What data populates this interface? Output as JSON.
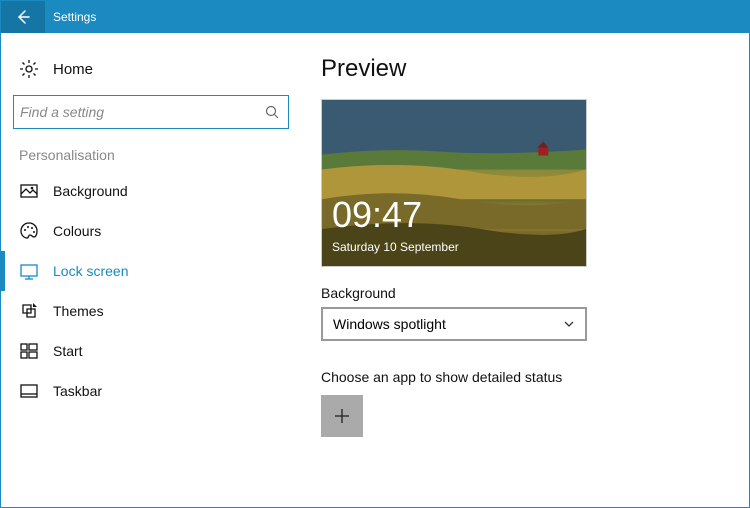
{
  "window": {
    "title": "Settings"
  },
  "sidebar": {
    "home_label": "Home",
    "search_placeholder": "Find a setting",
    "section_title": "Personalisation",
    "items": [
      {
        "label": "Background"
      },
      {
        "label": "Colours"
      },
      {
        "label": "Lock screen"
      },
      {
        "label": "Themes"
      },
      {
        "label": "Start"
      },
      {
        "label": "Taskbar"
      }
    ]
  },
  "main": {
    "heading": "Preview",
    "clock_time": "09:47",
    "clock_date": "Saturday 10 September",
    "background_label": "Background",
    "background_value": "Windows spotlight",
    "status_label": "Choose an app to show detailed status"
  }
}
